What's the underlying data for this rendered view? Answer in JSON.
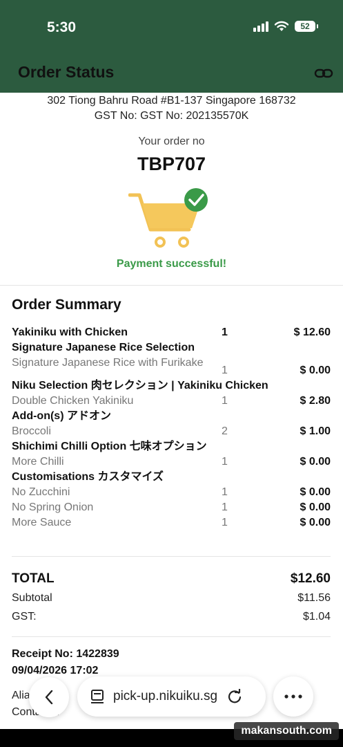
{
  "status_bar": {
    "time": "5:30",
    "battery": "52"
  },
  "header": {
    "title": "Order Status",
    "link_icon": "link-icon"
  },
  "store": {
    "address": "302 Tiong Bahru Road #B1-137 Singapore 168732",
    "gst": "GST No: GST No: 202135570K"
  },
  "order": {
    "label": "Your order no",
    "number": "TBP707",
    "payment_status": "Payment successful!",
    "colors": {
      "cart": "#f5c85c",
      "check": "#3a9a48",
      "success_text": "#3a9a48"
    }
  },
  "summary": {
    "title": "Order Summary",
    "lines": [
      {
        "type": "item",
        "name": "Yakiniku with Chicken",
        "qty": "1",
        "price": "$ 12.60"
      },
      {
        "type": "group",
        "name": "Signature Japanese Rice Selection"
      },
      {
        "type": "option",
        "name": "Signature Japanese Rice with Furikake",
        "qty": "1",
        "price": "$ 0.00"
      },
      {
        "type": "group",
        "name": "Niku Selection 肉セレクション | Yakiniku Chicken"
      },
      {
        "type": "option",
        "name": "Double Chicken Yakiniku",
        "qty": "1",
        "price": "$ 2.80"
      },
      {
        "type": "group",
        "name": "Add-on(s) アドオン"
      },
      {
        "type": "option",
        "name": "Broccoli",
        "qty": "2",
        "price": "$ 1.00"
      },
      {
        "type": "group",
        "name": "Shichimi Chilli Option 七味オプション"
      },
      {
        "type": "option",
        "name": "More Chilli",
        "qty": "1",
        "price": "$ 0.00"
      },
      {
        "type": "group",
        "name": "Customisations カスタマイズ"
      },
      {
        "type": "option",
        "name": "No Zucchini",
        "qty": "1",
        "price": "$ 0.00"
      },
      {
        "type": "option",
        "name": "No Spring Onion",
        "qty": "1",
        "price": "$ 0.00"
      },
      {
        "type": "option",
        "name": "More Sauce",
        "qty": "1",
        "price": "$ 0.00"
      }
    ]
  },
  "totals": {
    "total_label": "TOTAL",
    "total_value": "$12.60",
    "subtotal_label": "Subtotal",
    "subtotal_value": "$11.56",
    "gst_label": "GST:",
    "gst_value": "$1.04"
  },
  "receipt": {
    "number": "Receipt No: 1422839",
    "datetime": "09/04/2026 17:02"
  },
  "partial_fields": {
    "alias": "Alia",
    "contact": "Conta   no:"
  },
  "browser": {
    "url": "pick-up.nikuiku.sg"
  },
  "watermark": "makansouth.com"
}
